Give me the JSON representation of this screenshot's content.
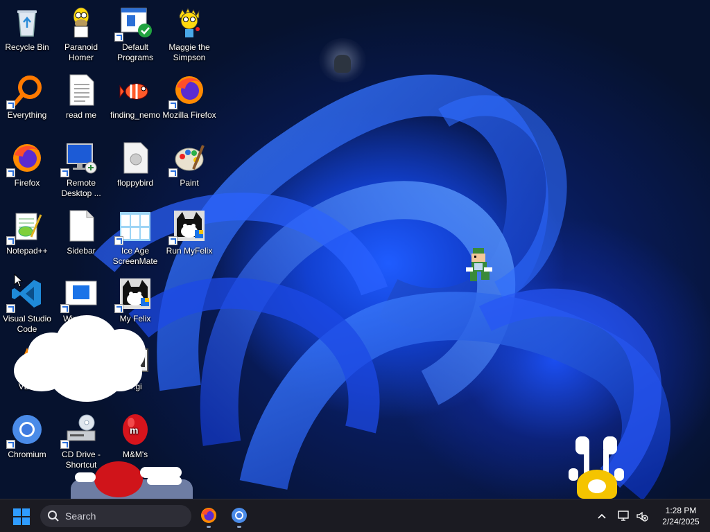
{
  "desktop_icons": [
    {
      "label": "Recycle Bin",
      "icon": "recycle-bin-icon"
    },
    {
      "label": "Paranoid Homer",
      "icon": "homer-icon"
    },
    {
      "label": "Default Programs",
      "icon": "default-programs-icon"
    },
    {
      "label": "Maggie the Simpson",
      "icon": "maggie-icon"
    },
    {
      "label": "Everything",
      "icon": "everything-icon"
    },
    {
      "label": "read me",
      "icon": "text-file-icon"
    },
    {
      "label": "finding_nemo",
      "icon": "nemo-icon"
    },
    {
      "label": "Mozilla Firefox",
      "icon": "firefox-icon"
    },
    {
      "label": "Firefox",
      "icon": "firefox-icon"
    },
    {
      "label": "Remote Desktop ...",
      "icon": "remote-desktop-icon"
    },
    {
      "label": "floppybird",
      "icon": "file-icon"
    },
    {
      "label": "Paint",
      "icon": "paint-icon"
    },
    {
      "label": "Notepad++",
      "icon": "notepadpp-icon"
    },
    {
      "label": "Sidebar",
      "icon": "blank-file-icon"
    },
    {
      "label": "Ice Age ScreenMate",
      "icon": "ice-age-icon"
    },
    {
      "label": "Run MyFelix",
      "icon": "felix-icon"
    },
    {
      "label": "Visual Studio Code",
      "icon": "vscode-icon"
    },
    {
      "label": "Window...",
      "icon": "window-icon"
    },
    {
      "label": "My Felix",
      "icon": "felix-icon"
    },
    {
      "label": "VL...",
      "icon": "vlc-icon"
    },
    {
      "label": "...gi",
      "icon": "app-icon"
    },
    {
      "label": "Chromium",
      "icon": "chromium-icon"
    },
    {
      "label": "CD Drive - Shortcut",
      "icon": "cd-drive-icon"
    },
    {
      "label": "M&M's",
      "icon": "mm-icon"
    }
  ],
  "taskbar": {
    "search_placeholder": "Search",
    "pinned": [
      {
        "name": "Firefox",
        "icon": "firefox-icon"
      },
      {
        "name": "Chromium",
        "icon": "chromium-icon"
      }
    ],
    "clock_time": "1:28 PM",
    "clock_date": "2/24/2025"
  },
  "colors": {
    "wallpaper_blue": "#1a4cf0",
    "taskbar_bg": "#1b1b22",
    "start_blue": "#2f9cff"
  }
}
